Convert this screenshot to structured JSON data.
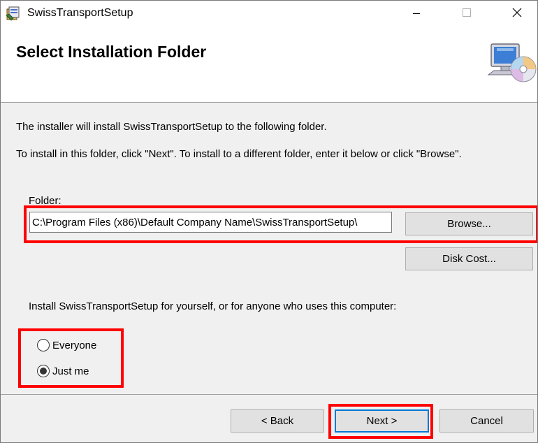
{
  "window": {
    "title": "SwissTransportSetup",
    "icon": "installer-package-icon",
    "controls": {
      "minimize": "minimize-icon",
      "maximize": "maximize-icon",
      "close": "close-icon"
    }
  },
  "header": {
    "title": "Select Installation Folder",
    "icon": "computer-cd-icon"
  },
  "body": {
    "description_1": "The installer will install SwissTransportSetup to the following folder.",
    "description_2": "To install in this folder, click \"Next\". To install to a different folder, enter it below or click \"Browse\".",
    "folder_label": "Folder:",
    "folder_value": "C:\\Program Files (x86)\\Default Company Name\\SwissTransportSetup\\",
    "browse_label": "Browse...",
    "disk_cost_label": "Disk Cost...",
    "install_for_text": "Install SwissTransportSetup for yourself, or for anyone who uses this computer:",
    "radio_options": [
      {
        "label": "Everyone",
        "checked": false
      },
      {
        "label": "Just me",
        "checked": true
      }
    ]
  },
  "footer": {
    "back_label": "< Back",
    "next_label": "Next >",
    "cancel_label": "Cancel"
  },
  "colors": {
    "highlight": "#ff0000",
    "focus": "#0078d7",
    "button_bg": "#e1e1e1",
    "dialog_bg": "#f0f0f0"
  }
}
